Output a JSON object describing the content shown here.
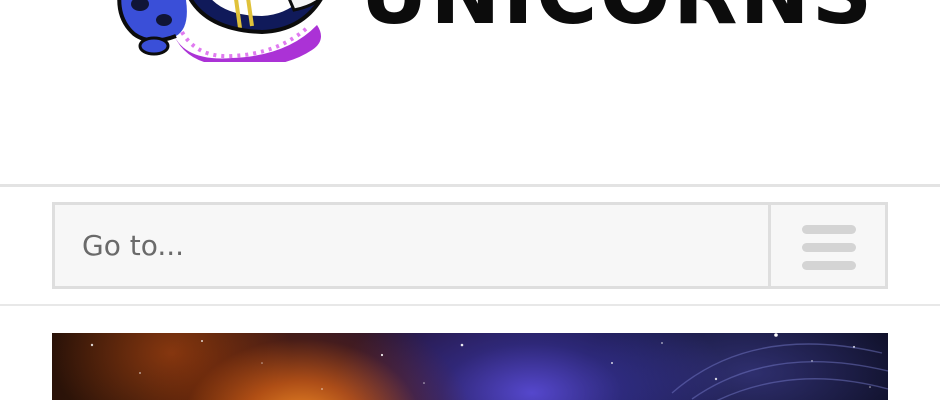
{
  "header": {
    "logo_wordmark": "UNICORNS"
  },
  "nav": {
    "select_label": "Go to...",
    "menu_icon": "hamburger-menu-icon"
  },
  "banner": {
    "image": "space-galaxy-banner"
  },
  "colors": {
    "nav_background": "#f7f7f7",
    "nav_border": "#dedede",
    "nav_text": "#6a6a6a",
    "hamburger": "#d4d4d4",
    "wordmark": "#0c0c0c",
    "mascot_blue": "#3a4fd8",
    "mascot_purple": "#a21cd1"
  }
}
